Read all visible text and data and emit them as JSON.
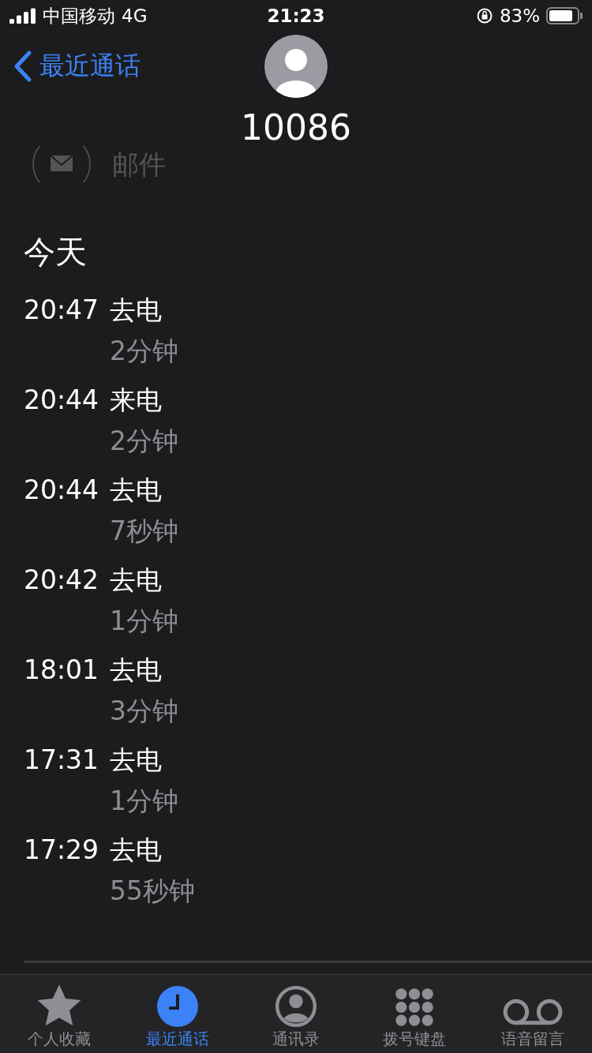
{
  "status_bar": {
    "carrier": "中国移动",
    "network": "4G",
    "time": "21:23",
    "battery": "83%"
  },
  "nav": {
    "back": "最近通话"
  },
  "contact": {
    "number": "10086"
  },
  "action": {
    "label": "邮件"
  },
  "section": {
    "title": "今天"
  },
  "calls": [
    {
      "time": "20:47",
      "type": "去电",
      "duration": "2分钟"
    },
    {
      "time": "20:44",
      "type": "来电",
      "duration": "2分钟"
    },
    {
      "time": "20:44",
      "type": "去电",
      "duration": "7秒钟"
    },
    {
      "time": "20:42",
      "type": "去电",
      "duration": "1分钟"
    },
    {
      "time": "18:01",
      "type": "去电",
      "duration": "3分钟"
    },
    {
      "time": "17:31",
      "type": "去电",
      "duration": "1分钟"
    },
    {
      "time": "17:29",
      "type": "去电",
      "duration": "55秒钟"
    }
  ],
  "tabs": [
    {
      "label": "个人收藏",
      "kind": "star",
      "selected": false
    },
    {
      "label": "最近通话",
      "kind": "clock",
      "selected": true
    },
    {
      "label": "通讯录",
      "kind": "person",
      "selected": false
    },
    {
      "label": "拨号键盘",
      "kind": "keypad",
      "selected": false
    },
    {
      "label": "语音留言",
      "kind": "voicemail",
      "selected": false
    }
  ]
}
